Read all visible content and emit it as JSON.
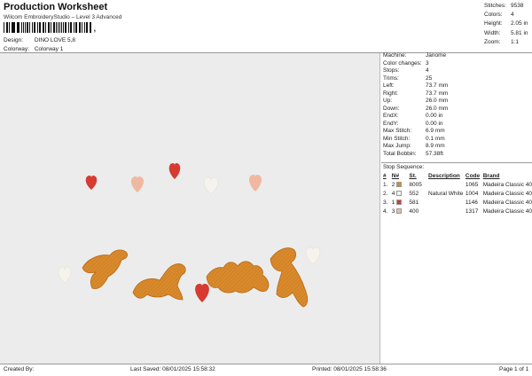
{
  "header": {
    "title": "Production Worksheet",
    "subtitle": "Wilcom EmbroideryStudio – Level 3 Advanced",
    "barcode_suffix": ","
  },
  "design_meta": [
    {
      "label": "Design:",
      "value": "DINO LOVE 5,8"
    },
    {
      "label": "Colorway:",
      "value": "Colorway 1"
    }
  ],
  "summary": [
    {
      "label": "Stitches:",
      "value": "9538"
    },
    {
      "label": "Colors:",
      "value": "4"
    },
    {
      "label": "Height:",
      "value": "2.05 in"
    },
    {
      "label": "Width:",
      "value": "5.81 in"
    },
    {
      "label": "Zoom:",
      "value": "1:1"
    }
  ],
  "specs": [
    {
      "label": "Machine:",
      "value": "Janome"
    },
    {
      "label": "Color changes:",
      "value": "3"
    },
    {
      "label": "Stops:",
      "value": "4"
    },
    {
      "label": "Trims:",
      "value": "25"
    },
    {
      "label": "Left:",
      "value": "73.7 mm"
    },
    {
      "label": "Right:",
      "value": "73.7 mm"
    },
    {
      "label": "Up:",
      "value": "26.0 mm"
    },
    {
      "label": "Down:",
      "value": "26.0 mm"
    },
    {
      "label": "EndX:",
      "value": "0.00 in"
    },
    {
      "label": "EndY:",
      "value": "0.00 in"
    },
    {
      "label": "Max Stitch:",
      "value": "6.9 mm"
    },
    {
      "label": "Min Stitch:",
      "value": "0.1 mm"
    },
    {
      "label": "Max Jump:",
      "value": "8.9 mm"
    },
    {
      "label": "Total Bobbin:",
      "value": "57.38ft"
    }
  ],
  "stop_sequence": {
    "title": "Stop Sequence:",
    "headers": [
      "#",
      "N#",
      "St.",
      "Description",
      "Code",
      "Brand"
    ],
    "rows": [
      {
        "num": "1.",
        "n": "2",
        "color": "#d98a2c",
        "st": "8005",
        "desc": "",
        "stitches": "1065",
        "brand": "Madeira Classic 40"
      },
      {
        "num": "2.",
        "n": "4",
        "color": "#f5f3ec",
        "st": "552",
        "desc": "Natural White",
        "stitches": "1004",
        "brand": "Madeira Classic 40"
      },
      {
        "num": "3.",
        "n": "1",
        "color": "#d63a30",
        "st": "581",
        "desc": "",
        "stitches": "1146",
        "brand": "Madeira Classic 40"
      },
      {
        "num": "4.",
        "n": "3",
        "color": "#f0b8a0",
        "st": "400",
        "desc": "",
        "stitches": "1317",
        "brand": "Madeira Classic 40"
      }
    ]
  },
  "footer": {
    "created_by": "Created By:",
    "last_saved": "Last Saved: 08/01/2025 15:58:32",
    "printed": "Printed: 08/01/2025 15:58:36",
    "page": "Page 1 of 1"
  },
  "colors": {
    "dino_fill": "#d98a2c",
    "dino_stitch": "#e8a850",
    "heart_red": "#d63a30",
    "heart_peach": "#f0b8a0",
    "heart_white": "#f5f3ec",
    "canvas_bg": "#ececec"
  }
}
